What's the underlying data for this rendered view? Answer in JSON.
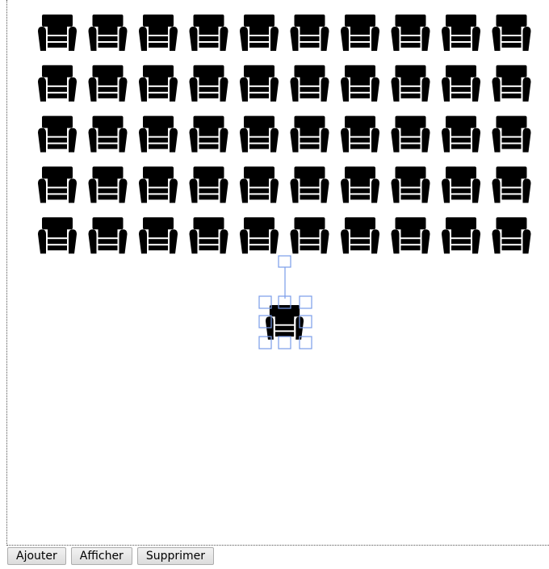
{
  "toolbar": {
    "add_label": "Ajouter",
    "show_label": "Afficher",
    "delete_label": "Supprimer"
  },
  "canvas": {
    "grid": {
      "rows": 5,
      "cols": 10
    },
    "item_icon": "armchair-icon",
    "selected_item_icon": "armchair-icon",
    "handle_color": "#7a9ce8",
    "item_color": "#000000"
  }
}
